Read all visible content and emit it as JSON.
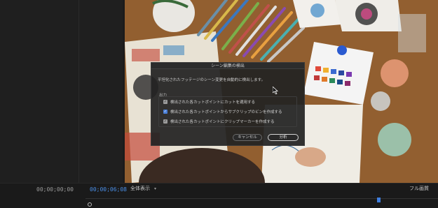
{
  "dialog": {
    "title": "シーン編集の検出",
    "description": "平坦化されたフッテージのシーン変更を自動的に検出します。",
    "group_label": "出力",
    "options": [
      {
        "label": "検出された各カットポイントにカットを適用する",
        "checked": true
      },
      {
        "label": "検出された各カットポイントからサブクリップのビンを作成する",
        "checked": true
      },
      {
        "label": "検出された各カットポイントにクリップマーカーを作成する",
        "checked": true
      }
    ],
    "cancel_label": "キャンセル",
    "analyze_label": "分析"
  },
  "source_monitor": {
    "timecode": "00;00;00;00"
  },
  "program_monitor": {
    "timecode": "00;00;06;08",
    "fit_value": "全体表示",
    "quality_value": "フル画質"
  },
  "colors": {
    "accent": "#4a8fe8",
    "checkbox_blue": "#4a7fd8"
  }
}
